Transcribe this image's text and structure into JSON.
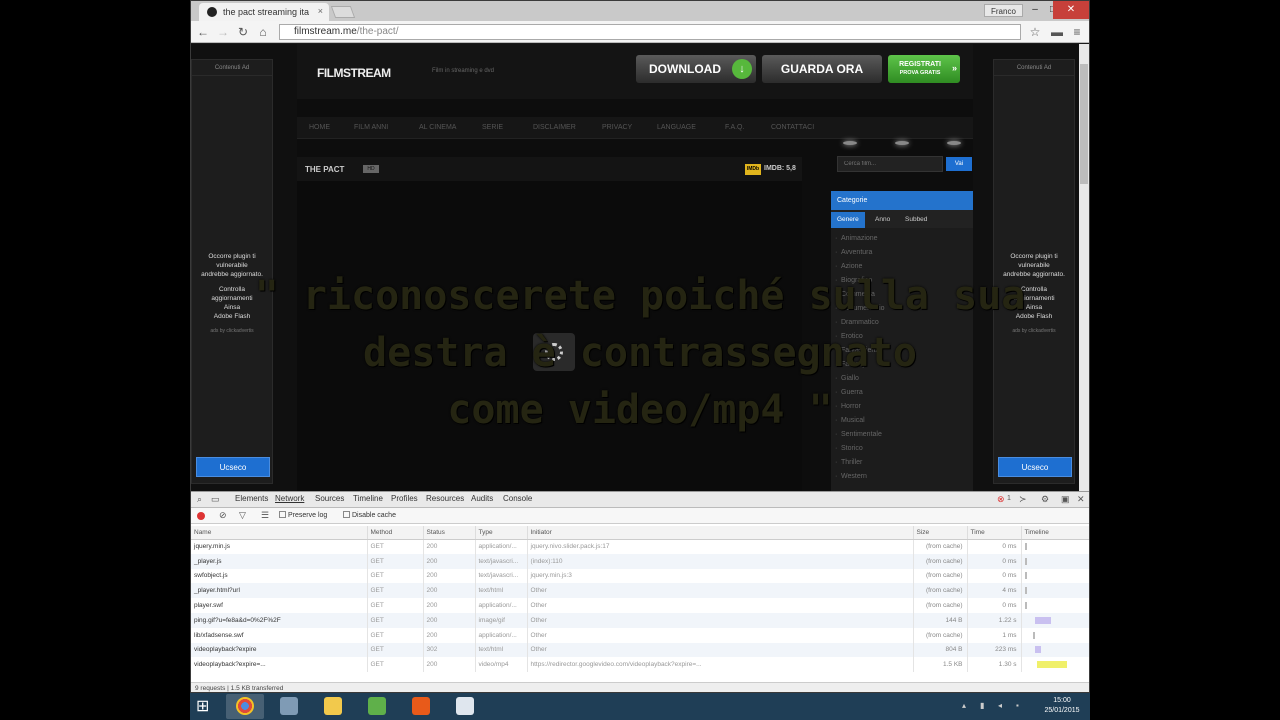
{
  "browser": {
    "tab_title": "the pact streaming ita",
    "tab_close": "×",
    "user": "Franco",
    "url_host": "filmstream.me",
    "url_path": "/the-pact/",
    "minimize": "–",
    "maximize": "□",
    "close": "✕"
  },
  "ads": {
    "top_label": "Contenuti Ad",
    "lines": [
      "Occorre plugin ti",
      "vulnerabile",
      "andrebbe aggiornato.",
      "",
      "Controlla",
      "aggiornamenti",
      "Ainsa",
      "Adobe Flash"
    ],
    "small": "ads by clickadvertis",
    "button": "Ucseco"
  },
  "site": {
    "logo": "FILMSTREAM",
    "tagline": "Film in streaming e dvd",
    "download": "DOWNLOAD",
    "watch": "GUARDA ORA",
    "register": "REGISTRATI",
    "register_sub": "PROVA GRATIS",
    "nav": [
      "HOME",
      "FILM ANNI",
      "AL CINEMA",
      "SERIE",
      "DISCLAIMER",
      "PRIVACY",
      "LANGUAGE",
      "F.A.Q.",
      "CONTATTACI"
    ],
    "movie_title": "THE PACT",
    "hd_badge": "HD",
    "imdb_label": "IMDb",
    "imdb_score": "IMDB: 5,8",
    "search_placeholder": "Cerca film...",
    "search_button": "Vai",
    "categories": {
      "header": "Categorie",
      "tabs": [
        "Genere",
        "Anno",
        "Subbed"
      ],
      "genres": [
        "Animazione",
        "Avventura",
        "Azione",
        "Biografico",
        "Commedia",
        "Documentario",
        "Drammatico",
        "Erotico",
        "Fantascienza",
        "Fantasy",
        "Giallo",
        "Guerra",
        "Horror",
        "Musical",
        "Sentimentale",
        "Storico",
        "Thriller",
        "Western"
      ]
    }
  },
  "overlay": {
    "line1": "\" riconoscerete poiché sulla sua",
    "line2": "destra è contrassegnato",
    "line3": "come video/mp4 \""
  },
  "devtools": {
    "tabs": [
      "Elements",
      "Network",
      "Sources",
      "Timeline",
      "Profiles",
      "Resources",
      "Audits",
      "Console"
    ],
    "preserve_log": "Preserve log",
    "disable_cache": "Disable cache",
    "error_count": "1",
    "columns": [
      "Name",
      "Method",
      "Status",
      "Type",
      "Initiator",
      "Size",
      "Time",
      "Timeline"
    ],
    "rows": [
      {
        "name": "jquery.min.js",
        "method": "GET",
        "status": "200",
        "type": "application/...",
        "initiator": "jquery.nivo.slider.pack.js:17",
        "size": "(from cache)",
        "time": "0 ms"
      },
      {
        "name": "_player.js",
        "method": "GET",
        "status": "200",
        "type": "text/javascri...",
        "initiator": "(index):110",
        "size": "(from cache)",
        "time": "0 ms"
      },
      {
        "name": "swfobject.js",
        "method": "GET",
        "status": "200",
        "type": "text/javascri...",
        "initiator": "jquery.min.js:3",
        "size": "(from cache)",
        "time": "0 ms"
      },
      {
        "name": "_player.html?url",
        "method": "GET",
        "status": "200",
        "type": "text/html",
        "initiator": "Other",
        "size": "(from cache)",
        "time": "4 ms"
      },
      {
        "name": "player.swf",
        "method": "GET",
        "status": "200",
        "type": "application/...",
        "initiator": "Other",
        "size": "(from cache)",
        "time": "0 ms"
      },
      {
        "name": "ping.gif?u=fe8a&d=0%2F%2F",
        "method": "GET",
        "status": "200",
        "type": "image/gif",
        "initiator": "Other",
        "size": "144 B",
        "time": "1.22 s"
      },
      {
        "name": "lib/xfadsense.swf",
        "method": "GET",
        "status": "200",
        "type": "application/...",
        "initiator": "Other",
        "size": "(from cache)",
        "time": "1 ms"
      },
      {
        "name": "videoplayback?expire",
        "method": "GET",
        "status": "302",
        "type": "text/html",
        "initiator": "Other",
        "size": "804 B",
        "time": "223 ms"
      },
      {
        "name": "videoplayback?expire=...",
        "method": "GET",
        "status": "200",
        "type": "video/mp4",
        "initiator": "https://redirector.googlevideo.com/videoplayback?expire=...",
        "size": "1.5 KB",
        "time": "1.30 s"
      }
    ],
    "status_bar": "9 requests | 1.5 KB transferred"
  },
  "taskbar": {
    "time": "15:00",
    "date": "25/01/2015"
  }
}
